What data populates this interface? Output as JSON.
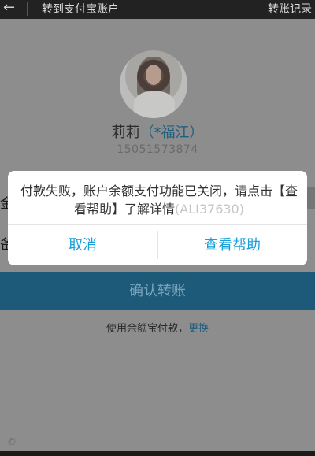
{
  "nav": {
    "back_icon": "←",
    "title": "转到支付宝账户",
    "record_label": "转账记录"
  },
  "profile": {
    "name": "莉莉",
    "nickname": "（*福江）",
    "account": "15051573874"
  },
  "form": {
    "amount_char": "金",
    "remark_char": "备",
    "confirm_label": "确认转账",
    "pay_method_text": "使用余额宝付款，",
    "switch_label": "更换"
  },
  "footer": {
    "copyright_symbol": "©"
  },
  "dialog": {
    "message": "付款失败，账户余额支付功能已关闭，请点击【查看帮助】了解详情",
    "ghost_text": "(ALI37630)",
    "cancel_label": "取消",
    "help_label": "查看帮助"
  },
  "colors": {
    "accent": "#1aa0d8",
    "confirm_button_dimmed": "#1d5a7a"
  }
}
